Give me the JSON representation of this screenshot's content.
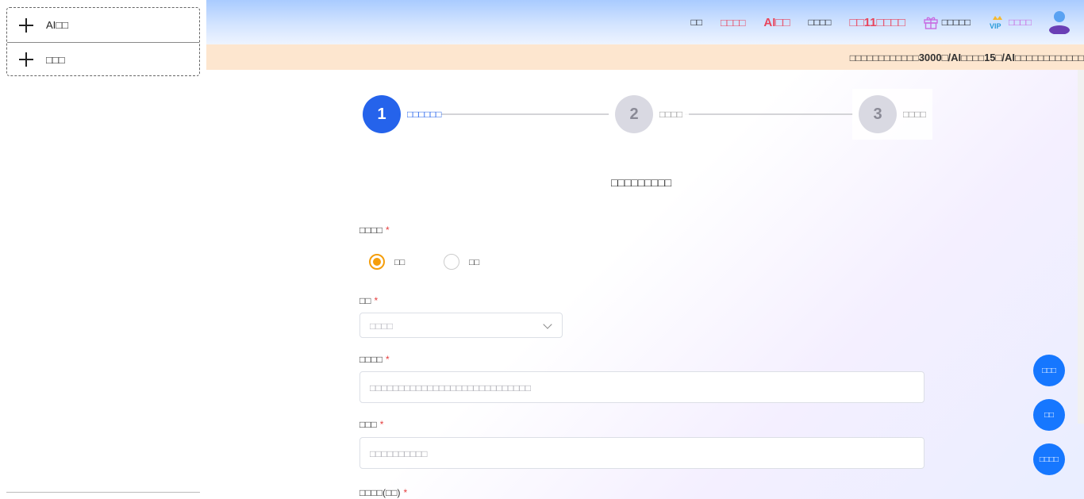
{
  "sidebar": {
    "items": [
      {
        "label": "AI□□"
      },
      {
        "label": "□□□"
      }
    ]
  },
  "nav": {
    "items": [
      {
        "label": "□□"
      },
      {
        "label": "□□□□"
      },
      {
        "label": "AI□□"
      },
      {
        "label": "□□□□"
      },
      {
        "label": "□□11□□□□"
      },
      {
        "label": "□□□□□"
      },
      {
        "label": "□□□□"
      }
    ]
  },
  "banner": {
    "prefix": "□□□□□□□□□□□□",
    "num1": "3000",
    "mid1": "□/AI",
    "mid2": "□□□□",
    "num2": "15",
    "mid3": "□/AI",
    "suffix": "□□□□□□□□□□□□"
  },
  "steps": [
    {
      "number": "1",
      "label": "□□□□□□",
      "active": true
    },
    {
      "number": "2",
      "label": "□□□□",
      "active": false
    },
    {
      "number": "3",
      "label": "□□□□",
      "active": false
    }
  ],
  "form": {
    "title": "□□□□□□□□□",
    "type_label": "□□□□",
    "type_options": [
      {
        "label": "□□",
        "checked": true
      },
      {
        "label": "□□",
        "checked": false
      }
    ],
    "category_label": "□□",
    "category_placeholder": "□□□□",
    "topic_label": "□□□□",
    "topic_placeholder": "□□□□□□□□□□□□□□□□□□□□□□□□□□□□",
    "keyword_label": "□□□",
    "keyword_placeholder": "□□□□□□□□□□",
    "wordcount_label": "□□□□(□□)",
    "required_mark": "*"
  },
  "float_buttons": [
    {
      "label": "□□□"
    },
    {
      "label": "□□"
    },
    {
      "label": "□□□□"
    }
  ],
  "colors": {
    "primary": "#2563eb",
    "accent_orange": "#f59e0b",
    "nav_red": "#e8455c",
    "float_blue": "#1677ff",
    "banner_bg": "#fde6cf"
  }
}
